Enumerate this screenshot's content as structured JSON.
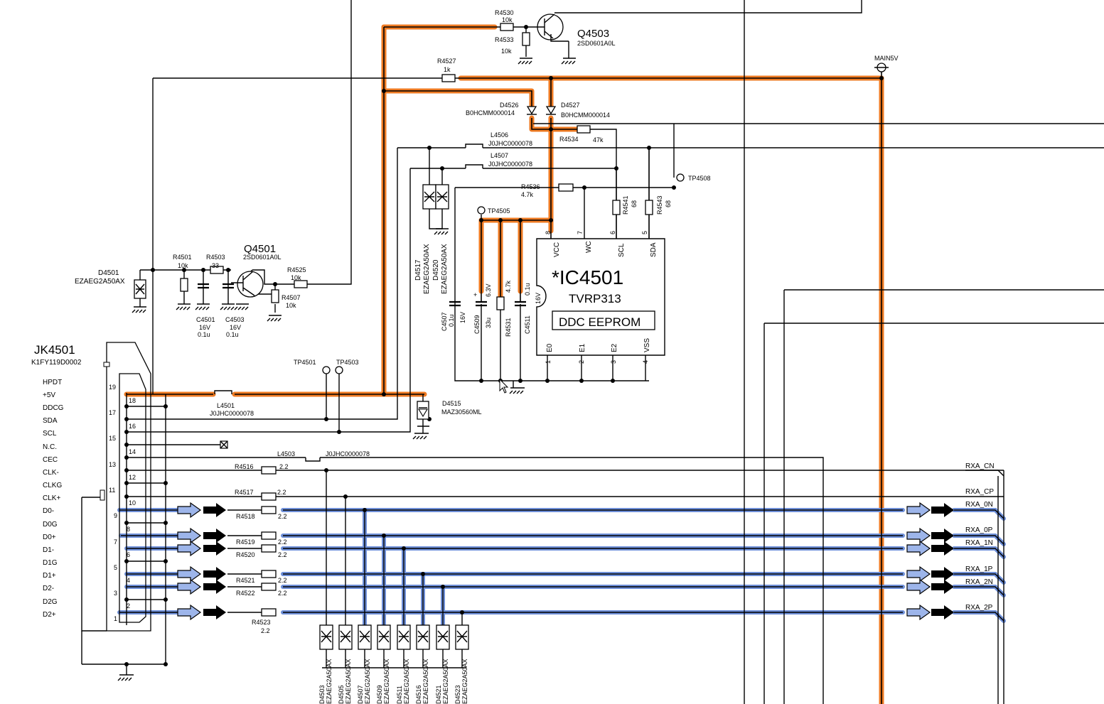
{
  "colors": {
    "power_net_highlight": "#ee7a22",
    "signal_net_highlight": "#6e8fd8",
    "wire": "#000000",
    "background": "#ffffff"
  },
  "connector": {
    "ref": "JK4501",
    "part": "K1FY119D0002",
    "signals": [
      "HPDT",
      "+5V",
      "DDCG",
      "SDA",
      "SCL",
      "N.C.",
      "CEC",
      "CLK-",
      "CLKG",
      "CLK+",
      "D0-",
      "D0G",
      "D0+",
      "D1-",
      "D1G",
      "D1+",
      "D2-",
      "D2G",
      "D2+"
    ],
    "pins_left": [
      "19",
      "17",
      "15",
      "13",
      "11",
      "9",
      "7",
      "5",
      "3",
      "1"
    ],
    "pins_right": [
      "18",
      "16",
      "14",
      "12",
      "10",
      "8",
      "6",
      "4",
      "2"
    ]
  },
  "ic": {
    "ref": "*IC4501",
    "part": "TVRP313",
    "function": "DDC EEPROM",
    "top_pins": [
      {
        "num": "8",
        "name": "VCC"
      },
      {
        "num": "7",
        "name": "WC"
      },
      {
        "num": "6",
        "name": "SCL"
      },
      {
        "num": "5",
        "name": "SDA"
      }
    ],
    "bottom_pins": [
      {
        "num": "1",
        "name": "E0"
      },
      {
        "num": "2",
        "name": "E1"
      },
      {
        "num": "3",
        "name": "E2"
      },
      {
        "num": "4",
        "name": "VSS"
      }
    ]
  },
  "transistors": {
    "q4503": {
      "ref": "Q4503",
      "part": "2SD0601A0L"
    },
    "q4501": {
      "ref": "Q4501",
      "part": "2SD0601A0L"
    }
  },
  "resistors": {
    "r4530": {
      "ref": "R4530",
      "value": "10k"
    },
    "r4533": {
      "ref": "R4533",
      "value": "10k"
    },
    "r4527": {
      "ref": "R4527",
      "value": "1k"
    },
    "r4534": {
      "ref": "R4534",
      "value": "47k"
    },
    "r4536": {
      "ref": "R4536",
      "value": "4.7k"
    },
    "r4541": {
      "ref": "R4541",
      "value": "68"
    },
    "r4543": {
      "ref": "R4543",
      "value": "68"
    },
    "r4531": {
      "ref": "R4531",
      "value": "4.7k"
    },
    "r4501": {
      "ref": "R4501",
      "value": "10k"
    },
    "r4503": {
      "ref": "R4503",
      "value": "33"
    },
    "r4525": {
      "ref": "R4525",
      "value": "10k"
    },
    "r4507": {
      "ref": "R4507",
      "value": "10k"
    },
    "r4516": {
      "ref": "R4516",
      "value": "2.2"
    },
    "r4517": {
      "ref": "R4517",
      "value": "2.2"
    },
    "r4518": {
      "ref": "R4518",
      "value": "2.2"
    },
    "r4519": {
      "ref": "R4519",
      "value": "2.2"
    },
    "r4520": {
      "ref": "R4520",
      "value": "2.2"
    },
    "r4521": {
      "ref": "R4521",
      "value": "2.2"
    },
    "r4522": {
      "ref": "R4522",
      "value": "2.2"
    },
    "r4523": {
      "ref": "R4523",
      "value": "2.2"
    }
  },
  "capacitors": {
    "c4507": {
      "ref": "C4507",
      "value": "0.1u",
      "voltage": "16V"
    },
    "c4509": {
      "ref": "C4509",
      "value": "33u",
      "voltage": "6.3V",
      "polarity": "+"
    },
    "c4511": {
      "ref": "C4511",
      "value": "0.1u",
      "voltage": "16V"
    },
    "c4501": {
      "ref": "C4501",
      "value": "0.1u",
      "voltage": "16V"
    },
    "c4503": {
      "ref": "C4503",
      "value": "0.1u",
      "voltage": "16V"
    }
  },
  "diodes": {
    "d4526": {
      "ref": "D4526",
      "part": "B0HCMM000014"
    },
    "d4527": {
      "ref": "D4527",
      "part": "B0HCMM000014"
    },
    "d4501": {
      "ref": "D4501",
      "part": "EZAEG2A50AX"
    },
    "d4515": {
      "ref": "D4515",
      "part": "MAZ30560ML"
    },
    "d4517": {
      "ref": "D4517",
      "part": "EZAEG2A50AX"
    },
    "d4520": {
      "ref": "D4520",
      "part": "EZAEG2A50AX"
    },
    "bottom_array": [
      {
        "ref": "D4503",
        "part": "EZAEG2A50AX"
      },
      {
        "ref": "D4505",
        "part": "EZAEG2A50AX"
      },
      {
        "ref": "D4507",
        "part": "EZAEG2A50AX"
      },
      {
        "ref": "D4509",
        "part": "EZAEG2A50AX"
      },
      {
        "ref": "D4511",
        "part": "EZAEG2A50AX"
      },
      {
        "ref": "D4516",
        "part": "EZAEG2A50AX"
      },
      {
        "ref": "D4521",
        "part": "EZAEG2A50AX"
      },
      {
        "ref": "D4523",
        "part": "EZAEG2A50AX"
      }
    ]
  },
  "inductors": {
    "l4506": {
      "ref": "L4506",
      "part": "J0JHC0000078"
    },
    "l4507": {
      "ref": "L4507",
      "part": "J0JHC0000078"
    },
    "l4501": {
      "ref": "L4501",
      "part": "J0JHC0000078"
    },
    "l4503": {
      "ref": "L4503",
      "part": "J0JHC0000078"
    }
  },
  "test_points": [
    "TP4508",
    "TP4505",
    "TP4501",
    "TP4503"
  ],
  "power_rail": "MAIN5V",
  "outputs": [
    "RXA_CN",
    "RXA_CP",
    "RXA_0N",
    "RXA_0P",
    "RXA_1N",
    "RXA_1P",
    "RXA_2N",
    "RXA_2P"
  ]
}
